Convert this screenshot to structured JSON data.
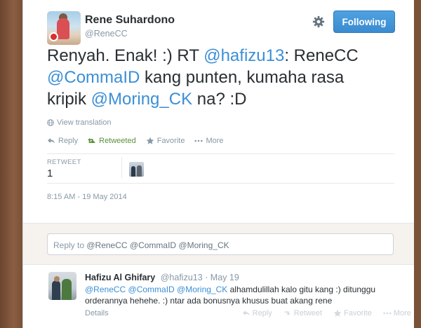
{
  "author": {
    "name": "Rene Suhardono",
    "handle": "@ReneCC"
  },
  "follow_button": "Following",
  "tweet": {
    "segments": [
      {
        "text": "Renyah. Enak! :) RT ",
        "mention": false
      },
      {
        "text": "@hafizu13",
        "mention": true
      },
      {
        "text": ": ReneCC ",
        "mention": false
      },
      {
        "text": "@CommaID",
        "mention": true
      },
      {
        "text": " kang punten, kumaha rasa kripik ",
        "mention": false
      },
      {
        "text": "@Moring_CK",
        "mention": true
      },
      {
        "text": " na? :D",
        "mention": false
      }
    ]
  },
  "view_translation": "View translation",
  "actions": {
    "reply": "Reply",
    "retweeted": "Retweeted",
    "favorite": "Favorite",
    "more": "More"
  },
  "stats": {
    "retweet_label": "RETWEET",
    "retweet_count": "1"
  },
  "timestamp": "8:15 AM - 19 May 2014",
  "reply_box": {
    "prefix": "Reply to ",
    "mentions": "@ReneCC @CommaID @Moring_CK"
  },
  "reply_tweet": {
    "name": "Hafizu Al Ghifary",
    "handle": "@hafizu13",
    "date": "· May 19",
    "line1_mentions": "@ReneCC @CommaID @Moring_CK",
    "line1_text": " alhamdulillah kalo gitu kang :) ditunggu",
    "line2": "orderannya hehehe. :) ntar ada bonusnya khusus buat akang rene",
    "details": "Details",
    "ghost_actions": [
      "Reply",
      "Retweet",
      "Favorite",
      "More"
    ]
  },
  "colors": {
    "accent": "#3b8fd6",
    "retweeted": "#5c913b",
    "follow_bg": "#3a8bd0",
    "frame": "#7a5238"
  }
}
